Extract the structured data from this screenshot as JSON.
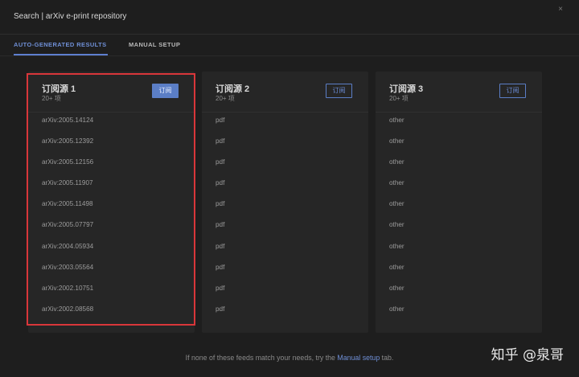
{
  "dialog": {
    "title": "Search | arXiv e-print repository",
    "close_symbol": "×"
  },
  "tabs": [
    {
      "label": "AUTO-GENERATED RESULTS",
      "active": true
    },
    {
      "label": "MANUAL SETUP",
      "active": false
    }
  ],
  "feeds": [
    {
      "title": "订阅源 1",
      "count": "20+ 项",
      "button": "订阅",
      "items": [
        "arXiv:2005.14124",
        "arXiv:2005.12392",
        "arXiv:2005.12156",
        "arXiv:2005.11907",
        "arXiv:2005.11498",
        "arXiv:2005.07797",
        "arXiv:2004.05934",
        "arXiv:2003.05564",
        "arXiv:2002.10751",
        "arXiv:2002.08568"
      ]
    },
    {
      "title": "订阅源 2",
      "count": "20+ 项",
      "button": "订阅",
      "items": [
        "pdf",
        "pdf",
        "pdf",
        "pdf",
        "pdf",
        "pdf",
        "pdf",
        "pdf",
        "pdf",
        "pdf"
      ]
    },
    {
      "title": "订阅源 3",
      "count": "20+ 项",
      "button": "订阅",
      "items": [
        "other",
        "other",
        "other",
        "other",
        "other",
        "other",
        "other",
        "other",
        "other",
        "other"
      ]
    }
  ],
  "footer": {
    "prefix": "If none of these feeds match your needs, try the ",
    "link": "Manual setup",
    "suffix": " tab."
  },
  "watermark": "知乎 @泉哥",
  "colors": {
    "accent": "#5b7ec6",
    "highlight": "#d9363a"
  }
}
